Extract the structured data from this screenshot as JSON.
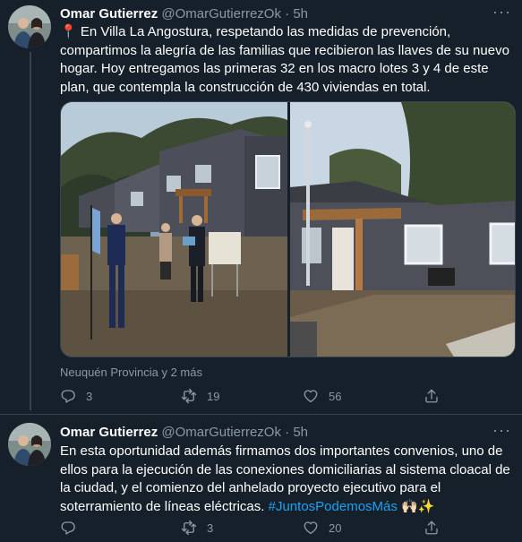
{
  "tweets": [
    {
      "author_name": "Omar Gutierrez",
      "author_handle": "@OmarGutierrezOk",
      "separator": "·",
      "time": "5h",
      "more_label": "···",
      "text": "📍 En Villa La Angostura, respetando las medidas de prevención, compartimos la alegría de las familias que recibieron las llaves de su nuevo hogar. Hoy entregamos las primeras 32 en los macro lotes 3 y 4 de este plan, que contempla la construcción de 430 viviendas en total.",
      "location": "Neuquén Provincia y 2 más",
      "reply_count": "3",
      "retweet_count": "19",
      "like_count": "56",
      "icons": [
        "reply-icon",
        "retweet-icon",
        "like-icon",
        "share-icon"
      ]
    },
    {
      "author_name": "Omar Gutierrez",
      "author_handle": "@OmarGutierrezOk",
      "separator": "·",
      "time": "5h",
      "more_label": "···",
      "text": "En esta oportunidad además firmamos dos importantes convenios, uno de ellos para la ejecución de las conexiones domiciliarias al sistema cloacal de la ciudad, y el comienzo del anhelado proyecto ejecutivo para el soterramiento de líneas eléctricas. ",
      "hashtag": "#JuntosPodemosMás",
      "emoji": " 🙌🏻✨",
      "reply_count": "",
      "retweet_count": "3",
      "like_count": "20",
      "icons": [
        "reply-icon",
        "retweet-icon",
        "like-icon",
        "share-icon"
      ]
    }
  ],
  "colors": {
    "background": "#15202b",
    "muted": "#8899a6",
    "link": "#1da1f2",
    "border": "#38444d"
  }
}
